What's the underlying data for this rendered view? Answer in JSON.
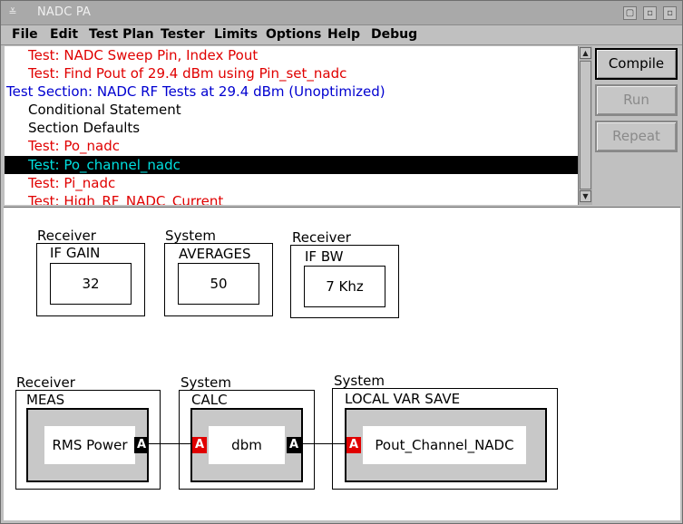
{
  "window": {
    "title": "NADC PA",
    "menu_glyph": "≚",
    "controls": [
      "▢",
      "▫",
      "▫"
    ]
  },
  "menu": {
    "items": [
      {
        "label": "File"
      },
      {
        "label": "Edit"
      },
      {
        "label": "Test Plan"
      },
      {
        "label": "Tester"
      },
      {
        "label": "Limits"
      },
      {
        "label": "Options"
      },
      {
        "label": "Help"
      },
      {
        "label": "Debug"
      }
    ]
  },
  "test_list": {
    "rows": [
      {
        "text": "Test: NADC Sweep Pin, Index Pout",
        "color": "#e00000"
      },
      {
        "text": "Test: Find Pout of 29.4 dBm using Pin_set_nadc",
        "color": "#e00000"
      },
      {
        "text": "Test Section: NADC RF Tests at 29.4 dBm (Unoptimized)",
        "color": "#0000d0"
      },
      {
        "text": "Conditional Statement",
        "color": "#000000"
      },
      {
        "text": "Section Defaults",
        "color": "#000000"
      },
      {
        "text": "Test: Po_nadc",
        "color": "#e00000"
      },
      {
        "text": "Test: Po_channel_nadc",
        "color": "#00e0e0",
        "selected": true
      },
      {
        "text": "Test: Pi_nadc",
        "color": "#e00000"
      },
      {
        "text": "Test: High_RF_NADC_Current",
        "color": "#e00000"
      }
    ],
    "scroll_up": "▲",
    "scroll_down": "▼"
  },
  "buttons": {
    "compile": "Compile",
    "run": "Run",
    "repeat": "Repeat"
  },
  "nodes": {
    "if_gain": {
      "category": "Receiver",
      "title": "IF GAIN",
      "value": "32"
    },
    "averages": {
      "category": "System",
      "title": "AVERAGES",
      "value": "50"
    },
    "if_bw": {
      "category": "Receiver",
      "title": "IF BW",
      "value": "7 Khz"
    },
    "meas": {
      "category": "Receiver",
      "title": "MEAS",
      "label": "RMS Power",
      "out_port": "A"
    },
    "calc": {
      "category": "System",
      "title": "CALC",
      "label": "dbm",
      "in_port": "A",
      "out_port": "A"
    },
    "local_var_save": {
      "category": "System",
      "title": "LOCAL VAR SAVE",
      "label": "Pout_Channel_NADC",
      "in_port": "A"
    }
  }
}
